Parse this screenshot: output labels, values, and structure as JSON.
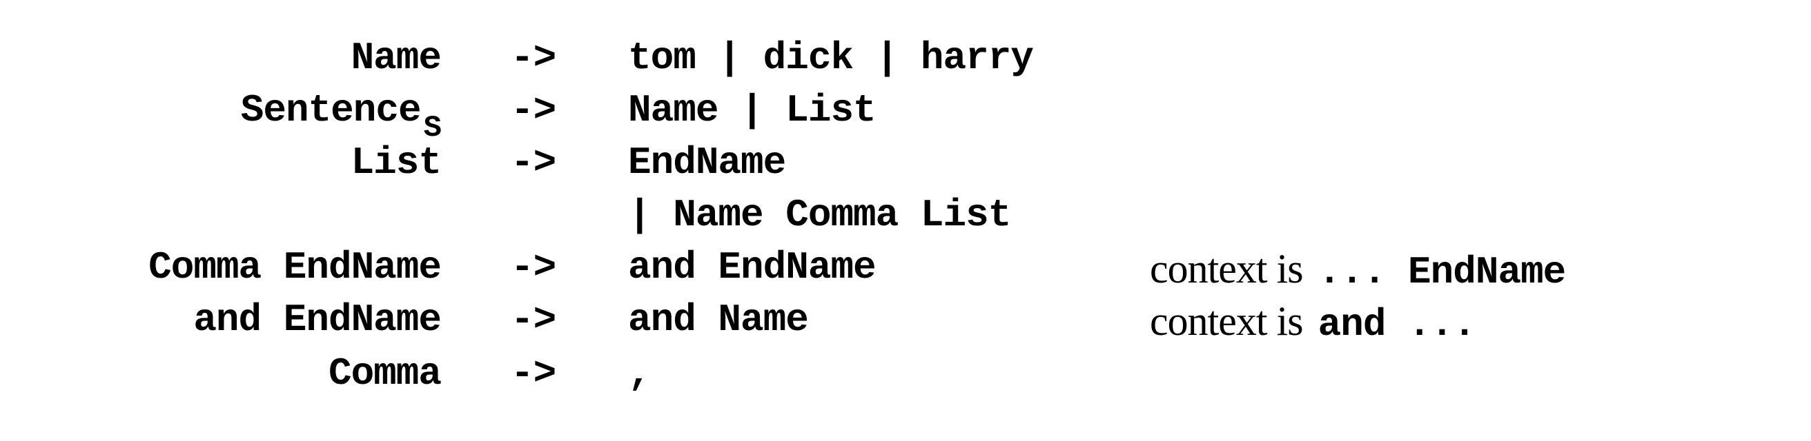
{
  "rules": [
    {
      "lhs": "Name",
      "arrow": "->",
      "rhs": "tom | dick | harry"
    },
    {
      "lhs": "Sentence",
      "lhs_sub": "S",
      "arrow": "->",
      "rhs": "Name | List"
    },
    {
      "lhs": "List",
      "arrow": "->",
      "rhs": "EndName"
    },
    {
      "rhs": "| Name Comma List"
    },
    {
      "lhs": "Comma EndName",
      "arrow": "->",
      "rhs": "and EndName",
      "context_label": "context is",
      "context_code": "... EndName"
    },
    {
      "lhs": "and EndName",
      "arrow": "->",
      "rhs": "and Name",
      "context_label": "context is",
      "context_code": "and ..."
    },
    {
      "lhs": "Comma",
      "arrow": "->",
      "rhs": ","
    }
  ]
}
